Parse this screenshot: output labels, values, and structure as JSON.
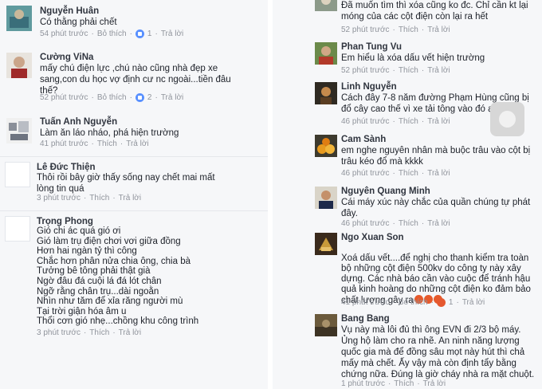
{
  "left_comments": [
    {
      "name": "Nguyễn Huân",
      "text": "Có thằng phải chết",
      "time": "54 phút trước",
      "unlike": "Bỏ thích",
      "likes": "1",
      "reply": "Trả lời"
    },
    {
      "name": "Cường ViNa",
      "text": "mấy chú điện lực ,chú nào cũng nhà đẹp xe\nsang,con du học vợ định cư nc ngoài...tiền đâu\nthế?",
      "time": "52 phút trước",
      "unlike": "Bỏ thích",
      "likes": "2",
      "reply": "Trả lời"
    },
    {
      "name": "Tuấn Anh Nguyễn",
      "text": "Làm ăn láo nháo, phá hiện trường",
      "time": "41 phút trước",
      "like": "Thích",
      "reply": "Trả lời"
    },
    {
      "name": "Lê Đức Thiện",
      "text": "Thôi rồi bây giờ thấy sống nay chết mai mất\nlòng tin quá",
      "time": "3 phút trước",
      "like": "Thích",
      "reply": "Trả lời"
    },
    {
      "name": "Trọng Phong",
      "text": "Gió chi ác quá gió ơi\nGió làm trụ điện chơi vơi giữa đồng\nHơn hai ngàn tỷ thì công\nChắc hơn phân nửa chia ông, chia bà\nTưởng bê tông phải thật già\nNgờ đâu đá cuội lá đá lót chân\nNgỡ rằng chân trụ...dài ngoằn\nNhìn như tăm để xỉa răng người mù\nTại trời giận hóa âm u\nThổi cơn gió nhẹ...chồng khu công trình",
      "time": "3 phút trước",
      "like": "Thích",
      "reply": "Trả lời"
    }
  ],
  "right_comments": [
    {
      "name": "",
      "text": "Đã muốn tìm thì xóa cũng ko đc. Chỉ cần kt lại\nmóng của các cột điện còn lại ra hết",
      "time": "52 phút trước",
      "like": "Thích",
      "reply": "Trả lời"
    },
    {
      "name": "Phan Tung Vu",
      "text": "Em hiểu là xóa dấu vết hiện trường",
      "time": "52 phút trước",
      "like": "Thích",
      "reply": "Trả lời"
    },
    {
      "name": "Linh Nguyễn",
      "text": "Cách đây 7-8 năm đường Phạm Hùng cũng bị\nđổ cây cao thế vì xe tải tông vào đó ạ",
      "time": "46 phút trước",
      "like": "Thích",
      "reply": "Trả lời"
    },
    {
      "name": "Cam Sành",
      "text": "em nghe nguyên nhân mà buộc trâu vào cột bị\ntrâu kéo đổ  mà kkkk",
      "time": "46 phút trước",
      "like": "Thích",
      "reply": "Trả lời"
    },
    {
      "name": "Nguyên Quang Minh",
      "text": "Cái máy xúc này chắc của quần chúng tự phát\nđây.",
      "time": "46 phút trước",
      "like": "Thích",
      "reply": "Trả lời"
    },
    {
      "name": "Ngo Xuan Son",
      "text": "Xoá dấu vết....để nghị cho thanh kiểm tra toàn\nbộ những cột điện 500kv do công ty này xây\ndựng. Các nhà báo cần vào cuộc để tránh hậu\nquả kinh hoàng do những cột điện ko đảm bảo\nchất lượng gây ra",
      "time": "41 phút trước",
      "unlike": "Bỏ thích",
      "likes": "1",
      "reply": "Trả lời"
    },
    {
      "name": "Bang Bang",
      "text": "Vụ này mà lôi đủ thì ông EVN đi 2/3 bộ máy.\nỦng hộ làm cho ra nhẽ. An ninh năng lượng\nquốc gia mà để đồng sâu mọt này hút thì chả\nmấy mà chết. Ấy vậy mà còn định tẩy bằng\nchứng nữa. Đúng là giờ cháy nhà ra mặt chuột.",
      "time": "1 phút trước",
      "like": "Thích",
      "reply": "Trả lời"
    }
  ],
  "colors": {
    "panel_bg": "#f6f7f9",
    "name_color": "#30353f",
    "meta_color": "#90949c",
    "like_blue": "#5890ff",
    "reaction_orange": "#e65a2c"
  },
  "icons": {
    "like": "thumbs-up-icon",
    "haha": "haha-reaction-icon",
    "angry": "angry-emoji-icon"
  }
}
